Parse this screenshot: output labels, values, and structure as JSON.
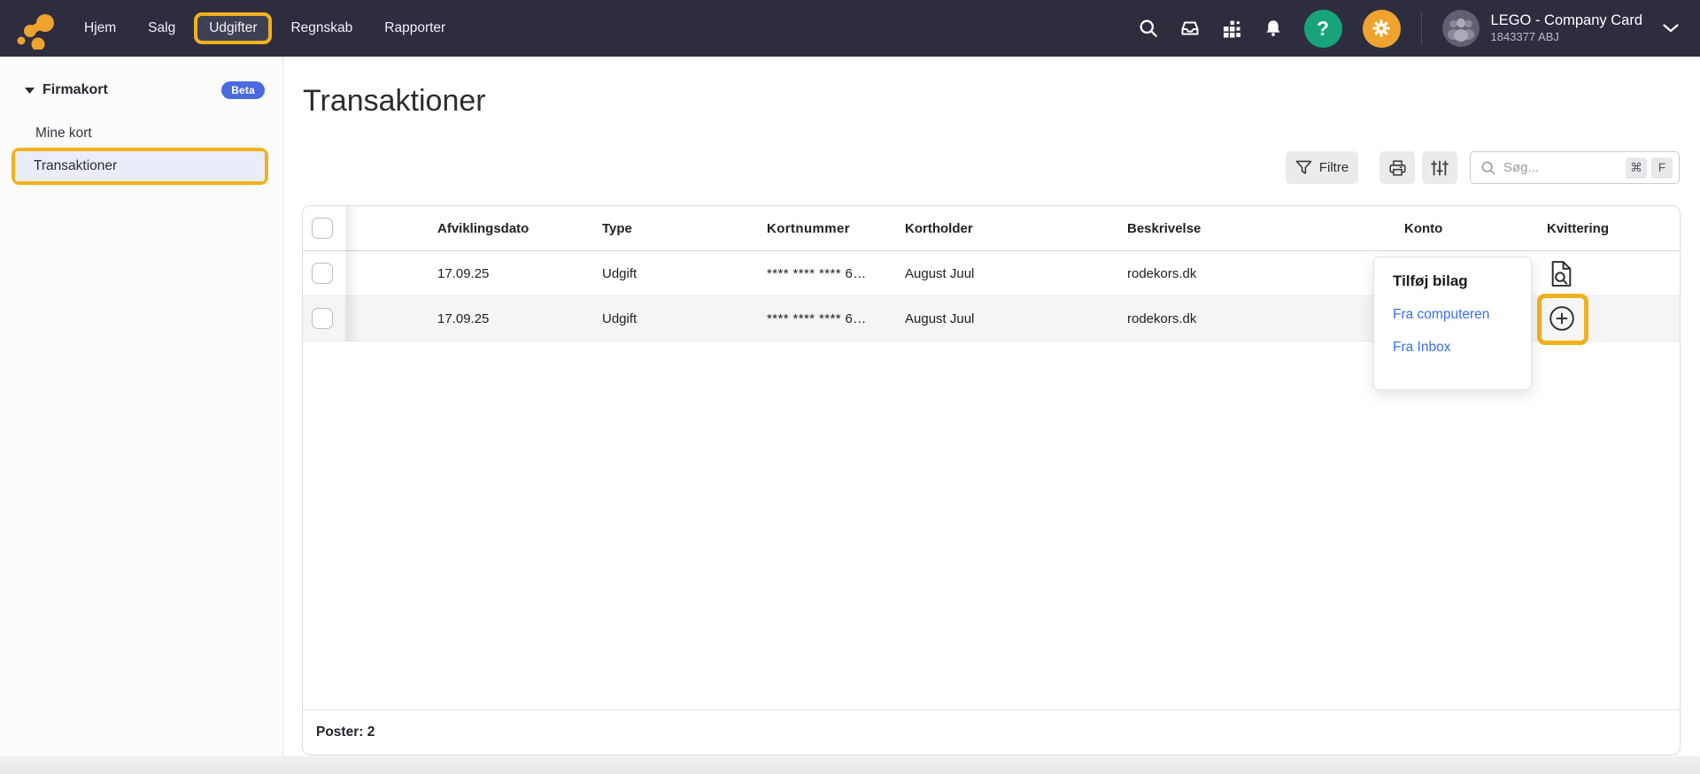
{
  "colors": {
    "topbar": "#2D2D3F",
    "highlight": "#F0B11D",
    "accent_green": "#16A478",
    "accent_orange": "#EFA32F",
    "badge": "#4A6BDD",
    "link": "#3B6FE0"
  },
  "topbar": {
    "nav": [
      {
        "label": "Hjem"
      },
      {
        "label": "Salg"
      },
      {
        "label": "Udgifter",
        "active": true
      },
      {
        "label": "Regnskab"
      },
      {
        "label": "Rapporter"
      }
    ],
    "icons": [
      "search-icon",
      "inbox-icon",
      "apps-grid-icon",
      "notifications-bell-icon",
      "help-icon",
      "gear-icon"
    ],
    "account": {
      "name": "LEGO - Company Card",
      "id": "1843377 ABJ"
    }
  },
  "sidebar": {
    "section": {
      "label": "Firmakort",
      "badge": "Beta"
    },
    "items": [
      {
        "label": "Mine kort",
        "selected": false
      },
      {
        "label": "Transaktioner",
        "selected": true
      }
    ]
  },
  "main": {
    "title": "Transaktioner",
    "toolbar": {
      "filter_label": "Filtre",
      "search_placeholder": "Søg...",
      "shortcut_mod": "⌘",
      "shortcut_key": "F"
    },
    "table": {
      "columns": [
        "Afviklingsdato",
        "Type",
        "Kortnummer",
        "Kortholder",
        "Beskrivelse",
        "Konto",
        "Kvittering"
      ],
      "rows": [
        {
          "date": "17.09.25",
          "type": "Udgift",
          "card": "**** **** **** 6…",
          "holder": "August Juul",
          "desc": "rodekors.dk",
          "konto": ""
        },
        {
          "date": "17.09.25",
          "type": "Udgift",
          "card": "**** **** **** 6…",
          "holder": "August Juul",
          "desc": "rodekors.dk",
          "konto": ""
        }
      ],
      "footer": "Poster: 2"
    }
  },
  "popup": {
    "title": "Tilføj bilag",
    "options": [
      {
        "label": "Fra computeren"
      },
      {
        "label": "Fra Inbox"
      }
    ]
  }
}
